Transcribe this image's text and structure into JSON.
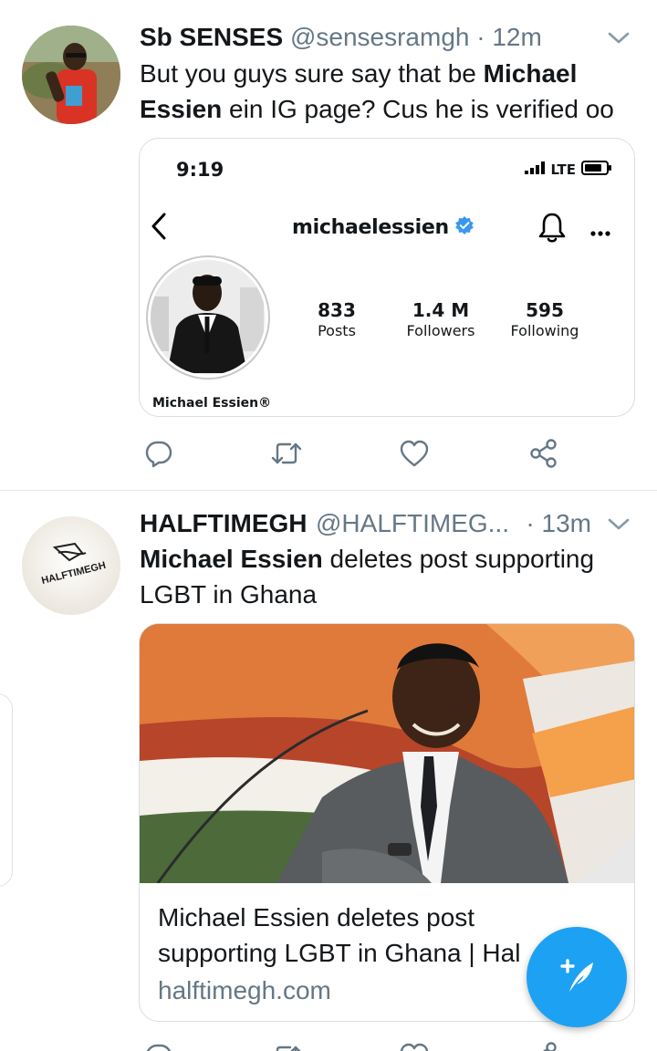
{
  "tweets": [
    {
      "name": "Sb SENSES",
      "handle": "@sensesramgh",
      "dot": "·",
      "time": "12m",
      "text_parts": [
        "But you guys sure say that be ",
        "Michael Essien",
        " ein IG page? Cus he is verified oo"
      ],
      "ig_screenshot": {
        "status_time": "9:19",
        "network": "LTE",
        "username": "michaelessien",
        "posts_count": "833",
        "posts_label": "Posts",
        "followers_count": "1.4 M",
        "followers_label": "Followers",
        "following_count": "595",
        "following_label": "Following",
        "full_name": "Michael Essien®"
      }
    },
    {
      "name": "HALFTIMEGH",
      "handle": "@HALFTIMEG...",
      "dot": "·",
      "time": "13m",
      "avatar_logo_text": "HALFTIMEGH",
      "text_parts": [
        "Michael Essien",
        " deletes post supporting LGBT in Ghana"
      ],
      "link_card": {
        "title": "Michael Essien deletes post supporting LGBT in Ghana | Hal",
        "domain": "halftimegh.com"
      }
    }
  ],
  "icons": {
    "reply": "reply-icon",
    "retweet": "retweet-icon",
    "like": "heart-icon",
    "share": "share-icon",
    "compose": "compose-tweet-icon",
    "caret": "chevron-down-icon",
    "verified": "verified-badge-icon"
  },
  "colors": {
    "twitter_blue": "#1da1f2",
    "secondary_text": "#657786",
    "primary_text": "#14171a",
    "instagram_verified": "#3897f0"
  }
}
